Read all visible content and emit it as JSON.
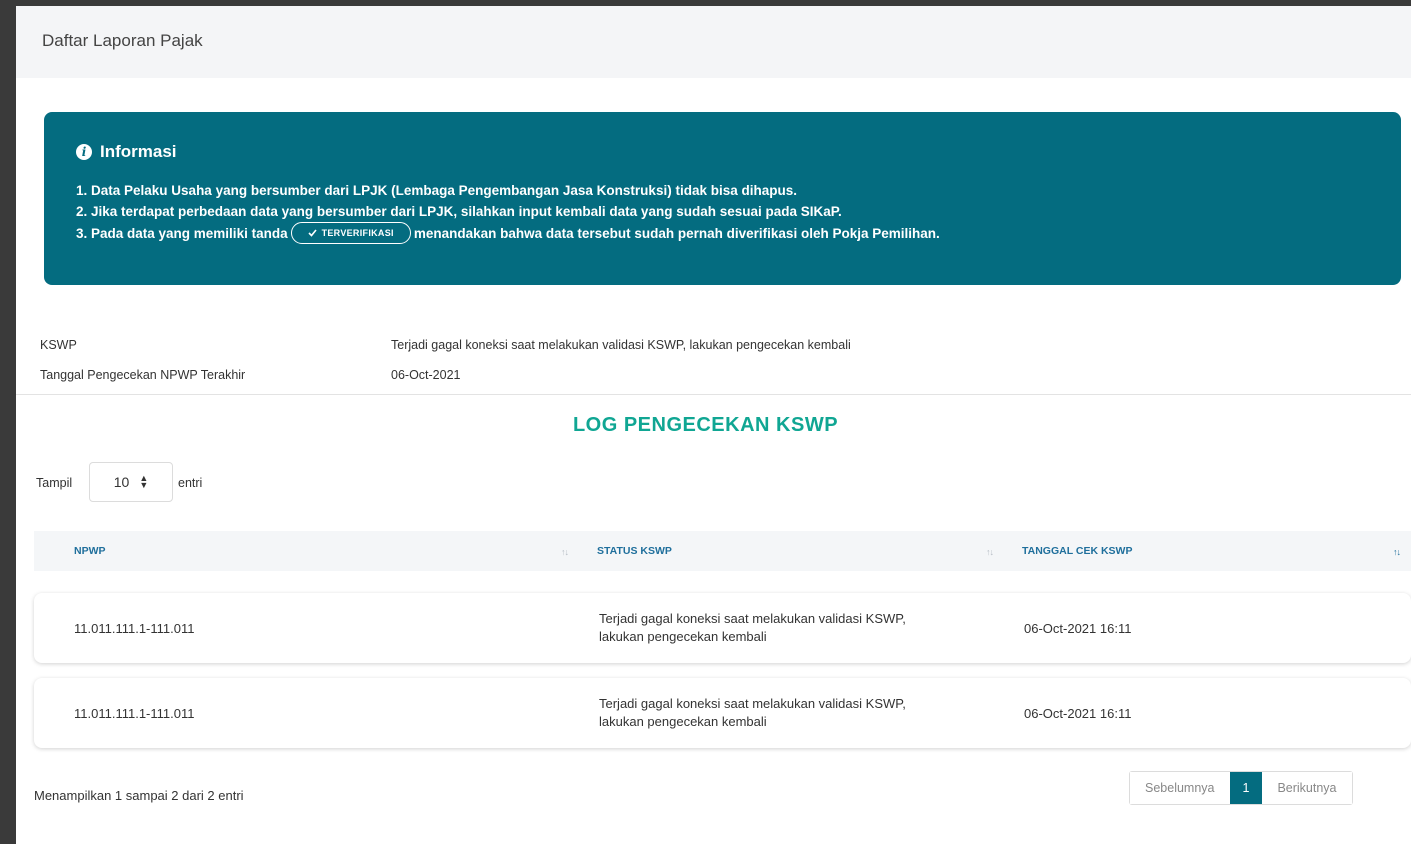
{
  "header": {
    "title": "Daftar Laporan Pajak"
  },
  "info": {
    "title": "Informasi",
    "line1": "1. Data Pelaku Usaha yang bersumber dari LPJK (Lembaga Pengembangan Jasa Konstruksi) tidak bisa dihapus.",
    "line2": "2. Jika terdapat perbedaan data yang bersumber dari LPJK, silahkan input kembali data yang sudah sesuai pada SIKaP.",
    "line3_before": "3. Pada data yang memiliki tanda",
    "chip_label": "TERVERIFIKASI",
    "line3_after": "menandakan bahwa data tersebut sudah pernah diverifikasi oleh Pokja Pemilihan."
  },
  "kswp": {
    "label": "KSWP",
    "value": "Terjadi gagal koneksi saat melakukan validasi KSWP, lakukan pengecekan kembali",
    "date_label": "Tanggal Pengecekan NPWP Terakhir",
    "date_value": "06-Oct-2021"
  },
  "log": {
    "title": "LOG PENGECEKAN KSWP",
    "length": {
      "prefix": "Tampil",
      "value": "10",
      "suffix": "entri"
    },
    "columns": [
      "NPWP",
      "STATUS KSWP",
      "TANGGAL CEK KSWP"
    ],
    "rows": [
      {
        "npwp": "11.011.111.1-111.011",
        "status_line1": "Terjadi gagal koneksi saat melakukan validasi KSWP,",
        "status_line2": "lakukan pengecekan kembali",
        "date": "06-Oct-2021 16:11"
      },
      {
        "npwp": "11.011.111.1-111.011",
        "status_line1": "Terjadi gagal koneksi saat melakukan validasi KSWP,",
        "status_line2": "lakukan pengecekan kembali",
        "date": "06-Oct-2021 16:11"
      }
    ],
    "summary": "Menampilkan 1 sampai 2 dari 2 entri",
    "pagination": {
      "prev": "Sebelumnya",
      "current": "1",
      "next": "Berikutnya"
    }
  },
  "colors": {
    "info_bg": "#046c80",
    "accent_title": "#10a693",
    "header_link": "#1f6f9c"
  },
  "icons": {
    "info": "info-circle-icon",
    "check": "check-icon",
    "sort": "sort-arrows-icon"
  }
}
